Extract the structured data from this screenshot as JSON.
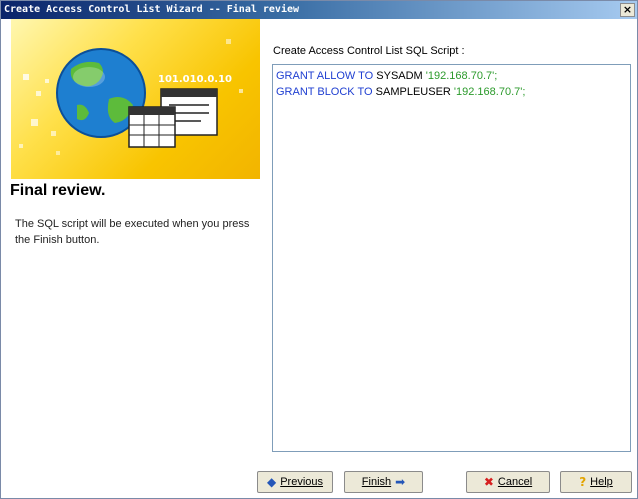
{
  "window": {
    "title": "Create Access Control List Wizard -- Final review",
    "close_label": "×"
  },
  "banner": {
    "ip_text": "101.010.0.10"
  },
  "left_panel": {
    "title": "Final review.",
    "description": "The SQL script will be executed when you press the Finish button."
  },
  "sql": {
    "label": "Create Access Control List SQL Script :",
    "lines": [
      {
        "keyword": "GRANT ALLOW TO",
        "object": "SYSADM",
        "value": "'192.168.70.7';"
      },
      {
        "keyword": "GRANT BLOCK TO",
        "object": "SAMPLEUSER",
        "value": "'192.168.70.7';"
      }
    ]
  },
  "buttons": {
    "previous_label": "Previous",
    "finish_label": "Finish",
    "cancel_label": "Cancel",
    "help_label": "Help"
  },
  "icons": {
    "previous": "arrow-left-icon",
    "finish": "arrow-right-icon",
    "cancel": "x-icon",
    "help": "question-icon"
  },
  "colors": {
    "keyword": "#1f3fd1",
    "string": "#2b9a2b",
    "titlebar_start": "#0a246a",
    "banner": "#f8c400"
  }
}
